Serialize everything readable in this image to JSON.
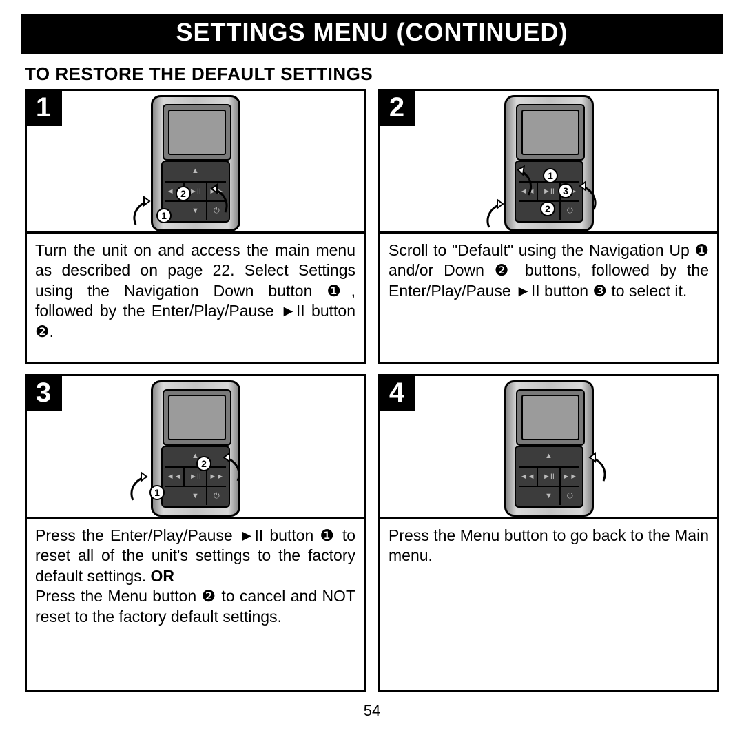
{
  "pageTitle": "SETTINGS MENU (CONTINUED)",
  "subHeading": "TO RESTORE THE DEFAULT SETTINGS",
  "steps": {
    "s1": {
      "num": "1",
      "text": "Turn the unit on and access the main menu as described on page 22. Select Settings using the Navigation Down button ❶, followed by the Enter/Play/Pause ►II button ❷."
    },
    "s2": {
      "num": "2",
      "text": "Scroll to \"Default\" using the Navigation Up ❶ and/or Down ❷ buttons, followed by the Enter/Play/Pause ►II button ❸ to select it."
    },
    "s3": {
      "num": "3",
      "t1": "Press the Enter/Play/Pause ►II button ❶ to reset all of the unit's settings to the factory default settings. ",
      "bold": "OR",
      "t2": "Press the Menu button ❷ to cancel and NOT reset to the factory default settings."
    },
    "s4": {
      "num": "4",
      "text": "Press the Menu button to go back to the Main menu."
    }
  },
  "pageNumber": "54"
}
